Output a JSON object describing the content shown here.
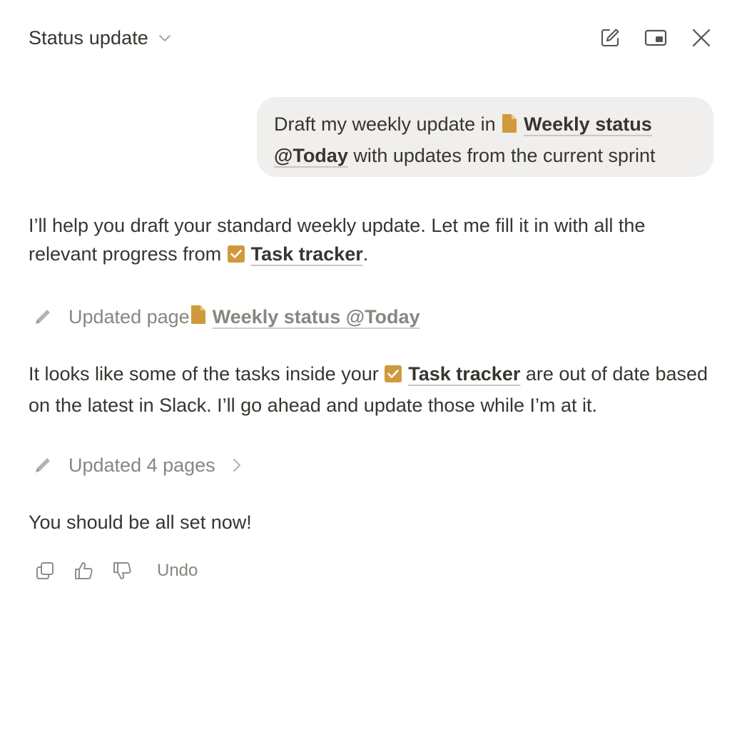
{
  "header": {
    "title": "Status update",
    "icons": [
      "chevron-down-icon",
      "compose-icon",
      "picture-in-picture-icon",
      "close-icon"
    ]
  },
  "user_message": {
    "text_before": "Draft my weekly update in ",
    "mention_1": "Weekly status",
    "mention_2": "@Today",
    "text_after": " with updates from the current sprint"
  },
  "assistant": {
    "p1_before": "I’ll help you draft your standard weekly update. Let me fill it in with all the relevant progress from ",
    "p1_mention": "Task tracker",
    "p1_after": ".",
    "action1_label": "Updated page ",
    "action1_mention": "Weekly status @Today",
    "p2_before": "It looks like some of the tasks inside your ",
    "p2_mention": "Task tracker",
    "p2_after": " are out of date based on the latest in Slack. I’ll go ahead and update those while I’m at it.",
    "action2_label": "Updated 4 pages",
    "p3": "You should be all set now!"
  },
  "footer": {
    "undo_label": "Undo",
    "icons": [
      "copy-icon",
      "thumbs-up-icon",
      "thumbs-down-icon"
    ]
  },
  "colors": {
    "text": "#37352f",
    "muted": "#87867f",
    "bubble_bg": "#f0efed",
    "page_icon": "#cf9a3e",
    "check_icon": "#cf9a3e"
  }
}
